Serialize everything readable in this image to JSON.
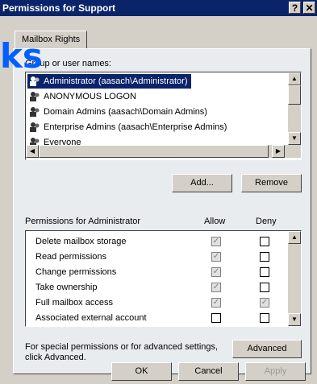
{
  "window": {
    "title": "Permissions for Support",
    "help_btn": "?",
    "close_btn": "✕"
  },
  "tab": {
    "label": "Mailbox Rights"
  },
  "users": {
    "label": "Group or user names:",
    "items": [
      {
        "label": "Administrator (aasach\\Administrator)",
        "selected": true
      },
      {
        "label": "ANONYMOUS LOGON"
      },
      {
        "label": "Domain Admins (aasach\\Domain Admins)"
      },
      {
        "label": "Enterprise Admins (aasach\\Enterprise Admins)"
      },
      {
        "label": "Everyone"
      }
    ],
    "add_button": "Add...",
    "remove_button": "Remove"
  },
  "permissions": {
    "label": "Permissions for Administrator",
    "allow_header": "Allow",
    "deny_header": "Deny",
    "rows": [
      {
        "name": "Delete mailbox storage",
        "allow": "checked-grey",
        "deny": "unchecked"
      },
      {
        "name": "Read permissions",
        "allow": "checked-grey",
        "deny": "unchecked"
      },
      {
        "name": "Change permissions",
        "allow": "checked-grey",
        "deny": "unchecked"
      },
      {
        "name": "Take ownership",
        "allow": "checked-grey",
        "deny": "unchecked"
      },
      {
        "name": "Full mailbox access",
        "allow": "checked-grey",
        "deny": "checked-grey"
      },
      {
        "name": "Associated external account",
        "allow": "unchecked",
        "deny": "unchecked"
      }
    ]
  },
  "advanced": {
    "text_line1": "For special permissions or for advanced settings,",
    "text_line2": "click Advanced.",
    "button": "Advanced"
  },
  "footer": {
    "ok": "OK",
    "cancel": "Cancel",
    "apply": "Apply"
  },
  "watermark": {
    "text": "ks"
  },
  "colors": {
    "titlebar": "#0a246a",
    "face": "#d4d0c8",
    "selection": "#0a246a",
    "watermark": "#0060ff"
  }
}
